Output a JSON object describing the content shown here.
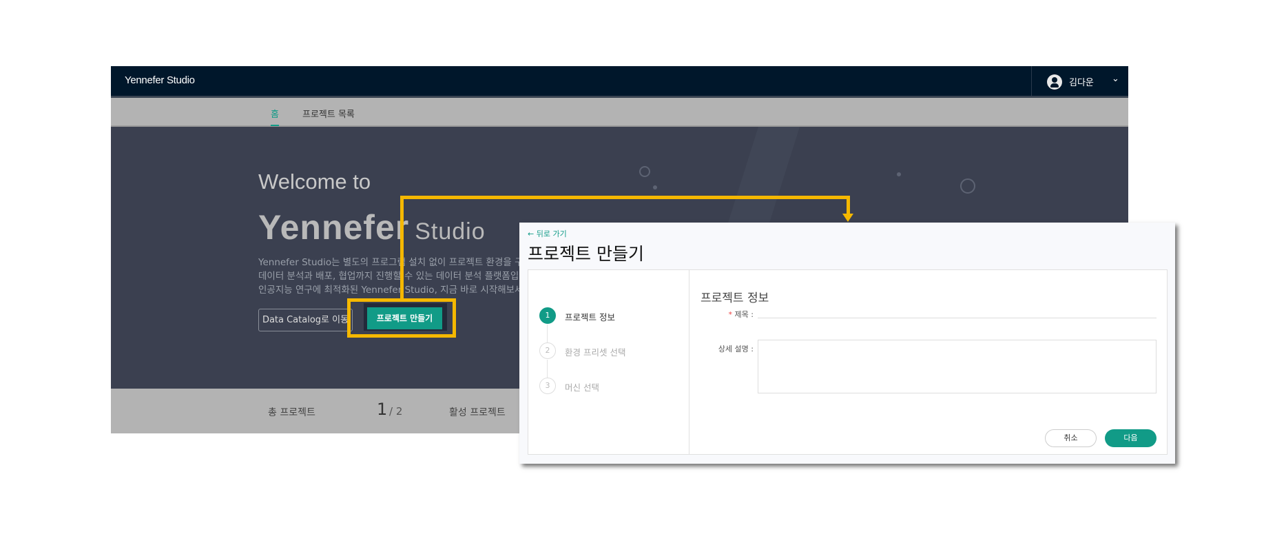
{
  "header": {
    "logo": "Yennefer Studio",
    "user_name": "김다운",
    "chevron": "⌄"
  },
  "nav": {
    "items": [
      {
        "label": "홈",
        "active": true
      },
      {
        "label": "프로젝트 목록",
        "active": false
      }
    ]
  },
  "hero": {
    "welcome": "Welcome to",
    "logo_main": "Yennefer",
    "logo_sub": "Studio",
    "paragraph": [
      "Yennefer Studio는 별도의 프로그램 설치 없이 프로젝트 환경을 구축하",
      "데이터 분석과 배포, 협업까지 진행할 수 있는 데이터 분석 플랫폼입니다",
      "인공지능 연구에 최적화된 Yennefer Studio, 지금 바로 시작해보세요."
    ],
    "catalog_button": "Data Catalog로 이동",
    "create_button": "프로젝트 만들기"
  },
  "stats": {
    "total_label": "총 프로젝트",
    "value": "1",
    "total": "/ 2",
    "active_label": "활성 프로젝트"
  },
  "modal": {
    "back": "← 뒤로 가기",
    "title": "프로젝트 만들기",
    "steps": [
      {
        "num": "1",
        "label": "프로젝트 정보",
        "active": true
      },
      {
        "num": "2",
        "label": "환경 프리셋 선택",
        "active": false
      },
      {
        "num": "3",
        "label": "머신 선택",
        "active": false
      }
    ],
    "form_title": "프로젝트 정보",
    "required_mark": "*",
    "title_label": "제목 :",
    "title_value": "",
    "desc_label": "상세 설명 :",
    "desc_value": "",
    "cancel": "취소",
    "next": "다음"
  },
  "colors": {
    "accent": "#119b87",
    "highlight": "#f5b800",
    "header": "#00172b",
    "hero": "#3b4050"
  }
}
